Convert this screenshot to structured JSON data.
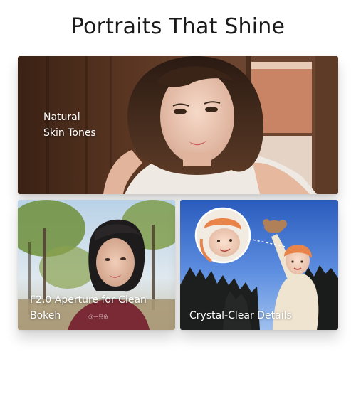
{
  "page": {
    "title": "Portraits That Shine"
  },
  "cards": {
    "natural": {
      "caption_line1": "Natural",
      "caption_line2": "Skin Tones"
    },
    "aperture": {
      "caption_line1": "F2.0 Aperture for Clean",
      "caption_line2": "Bokeh",
      "watermark": "@一只鱼"
    },
    "detail": {
      "caption": "Crystal-Clear Details"
    }
  },
  "colors": {
    "title": "#1a1a1a",
    "caption": "#ffffff",
    "background": "#ffffff"
  }
}
